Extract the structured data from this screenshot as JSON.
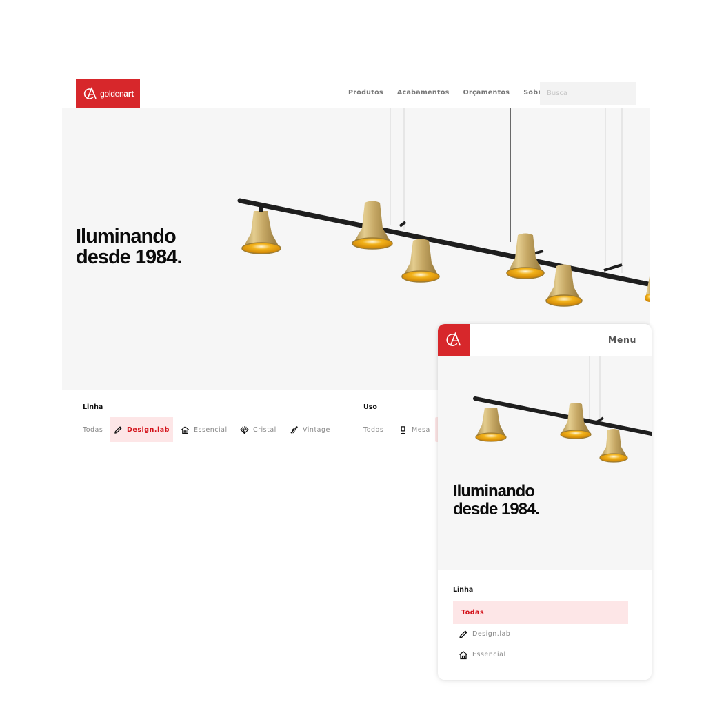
{
  "colors": {
    "brand": "#d7272b",
    "hero_bg": "#f6f6f6",
    "active_chip_bg": "#fde6e7",
    "active_text": "#d3121a",
    "search_bg": "#f3f3f3"
  },
  "desktop": {
    "brand": {
      "logo_light": "golden",
      "logo_bold": "art"
    },
    "nav": [
      "Produtos",
      "Acabamentos",
      "Orçamentos",
      "Sobre"
    ],
    "search": {
      "placeholder": "Busca"
    },
    "hero": {
      "title_line1": "Iluminando",
      "title_line2": "desde 1984."
    },
    "filters": {
      "linha": {
        "label": "Linha",
        "options": [
          {
            "label": "Todas",
            "icon": "",
            "active": false
          },
          {
            "label": "Design.lab",
            "icon": "pencil-icon",
            "active": true
          },
          {
            "label": "Essencial",
            "icon": "house-icon",
            "active": false
          },
          {
            "label": "Cristal",
            "icon": "diamond-icon",
            "active": false
          },
          {
            "label": "Vintage",
            "icon": "filament-icon",
            "active": false
          }
        ]
      },
      "uso": {
        "label": "Uso",
        "options": [
          {
            "label": "Todos",
            "icon": "",
            "active": false
          },
          {
            "label": "Mesa",
            "icon": "table-lamp-icon",
            "active": false
          }
        ]
      }
    }
  },
  "mobile": {
    "menu_label": "Menu",
    "hero": {
      "title_line1": "Iluminando",
      "title_line2": "desde 1984."
    },
    "filters": {
      "linha": {
        "label": "Linha",
        "options": [
          {
            "label": "Todas",
            "icon": "",
            "active": true
          },
          {
            "label": "Design.lab",
            "icon": "pencil-icon",
            "active": false
          },
          {
            "label": "Essencial",
            "icon": "house-icon",
            "active": false
          }
        ]
      }
    }
  }
}
